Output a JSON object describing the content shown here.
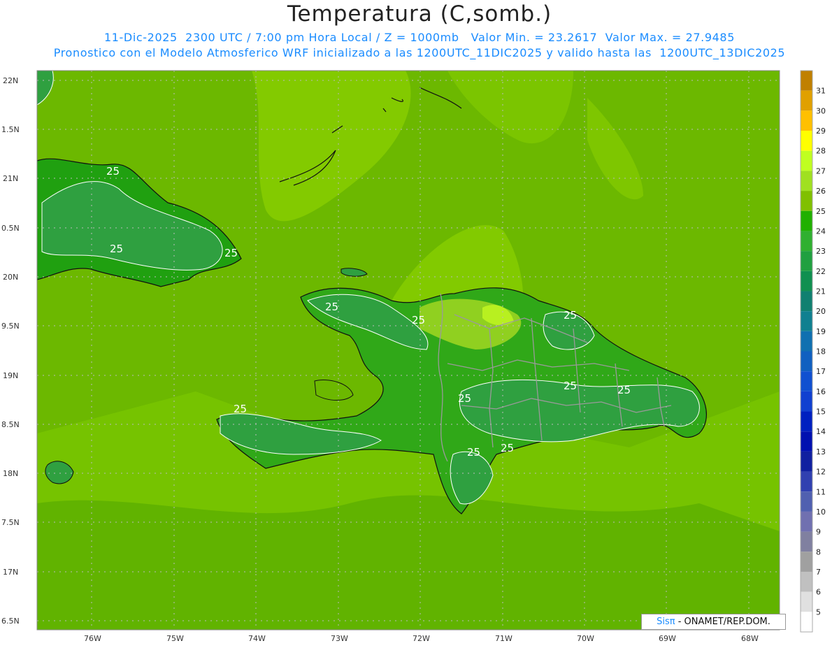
{
  "header": {
    "title": "Temperatura (C,somb.)",
    "line1": "11-Dic-2025  2300 UTC / 7:00 pm Hora Local / Z = 1000mb   Valor Min. = 23.2617  Valor Max. = 27.9485",
    "line2": "Pronostico con el Modelo Atmosferico WRF inicializado a las 1200UTC_11DIC2025 y valido hasta las  1200UTC_13DIC2025"
  },
  "map": {
    "lat_labels": [
      "22N",
      "1.5N",
      "21N",
      "0.5N",
      "20N",
      "9.5N",
      "19N",
      "8.5N",
      "18N",
      "7.5N",
      "17N",
      "6.5N"
    ],
    "lon_labels": [
      "76W",
      "75W",
      "74W",
      "73W",
      "72W",
      "71W",
      "70W",
      "69W",
      "68W"
    ],
    "contour_labels": [
      "25",
      "25",
      "25",
      "25",
      "25",
      "25",
      "25",
      "25",
      "25",
      "25",
      "25",
      "25"
    ],
    "regions": [
      "Cuba",
      "Haiti",
      "Republica Dominicana",
      "Jamaica",
      "Bahamas",
      "Isla de la Tortuga",
      "Isla de la Gonave"
    ]
  },
  "colorbar": {
    "labels": [
      "31",
      "30",
      "29",
      "28",
      "27",
      "26",
      "25",
      "24",
      "23",
      "22",
      "21",
      "20",
      "19",
      "18",
      "17",
      "16",
      "15",
      "14",
      "13",
      "12",
      "11",
      "10",
      "9",
      "8",
      "7",
      "6",
      "5"
    ],
    "colors": [
      "#c08000",
      "#e0a000",
      "#ffc000",
      "#ffff00",
      "#c0ff20",
      "#a0e020",
      "#80c000",
      "#20b000",
      "#30b030",
      "#20a040",
      "#109050",
      "#108070",
      "#108090",
      "#1070b0",
      "#1060c0",
      "#1050d0",
      "#1040d0",
      "#0020c0",
      "#0010b0",
      "#1020a0",
      "#3040b0",
      "#5060b0",
      "#7070b0",
      "#8080a0",
      "#a0a0a0",
      "#c0c0c0",
      "#e0e0e0",
      "#ffffff"
    ]
  },
  "credit": {
    "sis": "Sisπ",
    "rest": " - ONAMET/REP.DOM."
  },
  "colors": {
    "sea": "#7ec000",
    "land_warm": "#20b000",
    "coast": "#111111",
    "borders": "#999999",
    "header_blue": "#1a8cff"
  }
}
